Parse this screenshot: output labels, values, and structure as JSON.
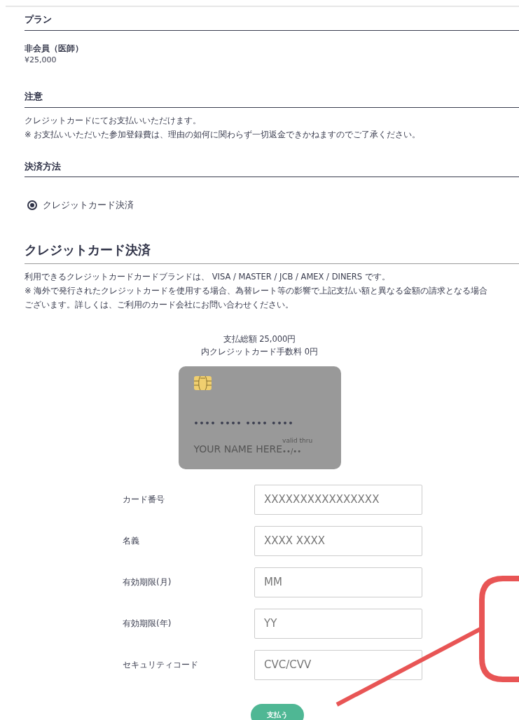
{
  "plan": {
    "heading": "プラン",
    "name": "非会員（医師）",
    "price": "¥25,000"
  },
  "notice": {
    "heading": "注意",
    "lines": [
      "クレジットカードにてお支払いいただけます。",
      "※ お支払いいただいた参加登録費は、理由の如何に関わらず一切返金できかねますのでご了承ください。"
    ]
  },
  "payment_method": {
    "heading": "決済方法",
    "options": [
      {
        "label": "クレジットカード決済",
        "selected": true
      }
    ]
  },
  "credit_card": {
    "heading": "クレジットカード決済",
    "lines": [
      "利用できるクレジットカードカードブランドは、 VISA / MASTER / JCB / AMEX / DINERS です。",
      "※ 海外で発行されたクレジットカードを使用する場合、為替レート等の影響で上記支払い額と異なる金額の請求となる場合",
      "ございます。詳しくは、ご利用のカード会社にお問い合わせください。"
    ],
    "total": "支払総額 25,000円",
    "fee": "内クレジットカード手数料 0円",
    "card_preview": {
      "number": "•••• •••• •••• ••••",
      "name": "YOUR NAME HERE",
      "valid_label": "valid thru",
      "expiry": "••/••"
    },
    "fields": [
      {
        "label": "カード番号",
        "placeholder": "XXXXXXXXXXXXXXXX"
      },
      {
        "label": "名義",
        "placeholder": "XXXX XXXX"
      },
      {
        "label": "有効期限(月)",
        "placeholder": "MM"
      },
      {
        "label": "有効期限(年)",
        "placeholder": "YY"
      },
      {
        "label": "セキュリティコード",
        "placeholder": "CVC/CVV"
      }
    ],
    "submit": "支払う"
  }
}
